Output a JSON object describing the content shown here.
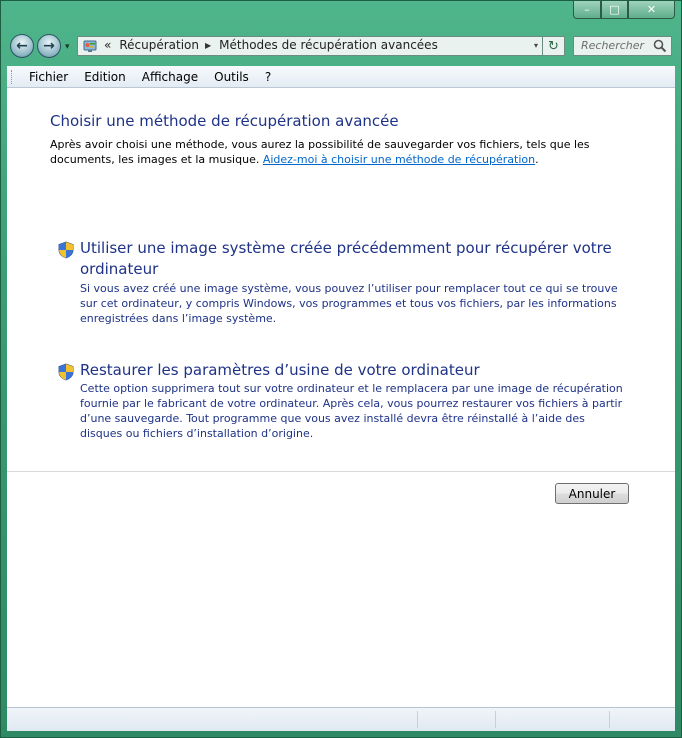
{
  "nav": {
    "back_label": "←",
    "forward_label": "→",
    "dropdown_label": "▾",
    "breadcrumb_prefix": "«",
    "breadcrumbs": [
      "Récupération",
      "Méthodes de récupération avancées"
    ],
    "breadcrumb_sep": "▶",
    "refresh_label": "↻",
    "search_placeholder": "Rechercher"
  },
  "window_controls": {
    "minimize": "–",
    "maximize": "□",
    "close": "✕"
  },
  "menu": {
    "items": [
      "Fichier",
      "Edition",
      "Affichage",
      "Outils",
      "?"
    ]
  },
  "main": {
    "title": "Choisir une méthode de récupération avancée",
    "intro_text": "Après avoir choisi une méthode, vous aurez la possibilité de sauvegarder vos fichiers, tels que les documents, les images et la musique.",
    "help_link": "Aidez-moi à choisir une méthode de récupération",
    "intro_end": ".",
    "options": [
      {
        "title": "Utiliser une image système créée précédemment pour récupérer votre ordinateur",
        "description": "Si vous avez créé une image système, vous pouvez l’utiliser pour remplacer tout ce qui se trouve sur cet ordinateur, y compris Windows, vos programmes et tous vos fichiers, par les informations enregistrées dans l’image système."
      },
      {
        "title": "Restaurer les paramètres d’usine de votre ordinateur",
        "description": "Cette option supprimera tout sur votre ordinateur et le remplacera par une image de récupération fournie par le fabricant de votre ordinateur. Après cela, vous pourrez restaurer vos fichiers à partir d’une sauvegarde. Tout programme que vous avez installé devra être réinstallé à l’aide des disques ou fichiers d’installation d’origine."
      }
    ],
    "cancel_label": "Annuler"
  },
  "colors": {
    "frame": "#3a9d73",
    "heading": "#1e3287",
    "link": "#0066cc"
  },
  "icons": {
    "address": "control-panel-icon",
    "search": "magnifier-icon",
    "option": "uac-shield-icon"
  }
}
